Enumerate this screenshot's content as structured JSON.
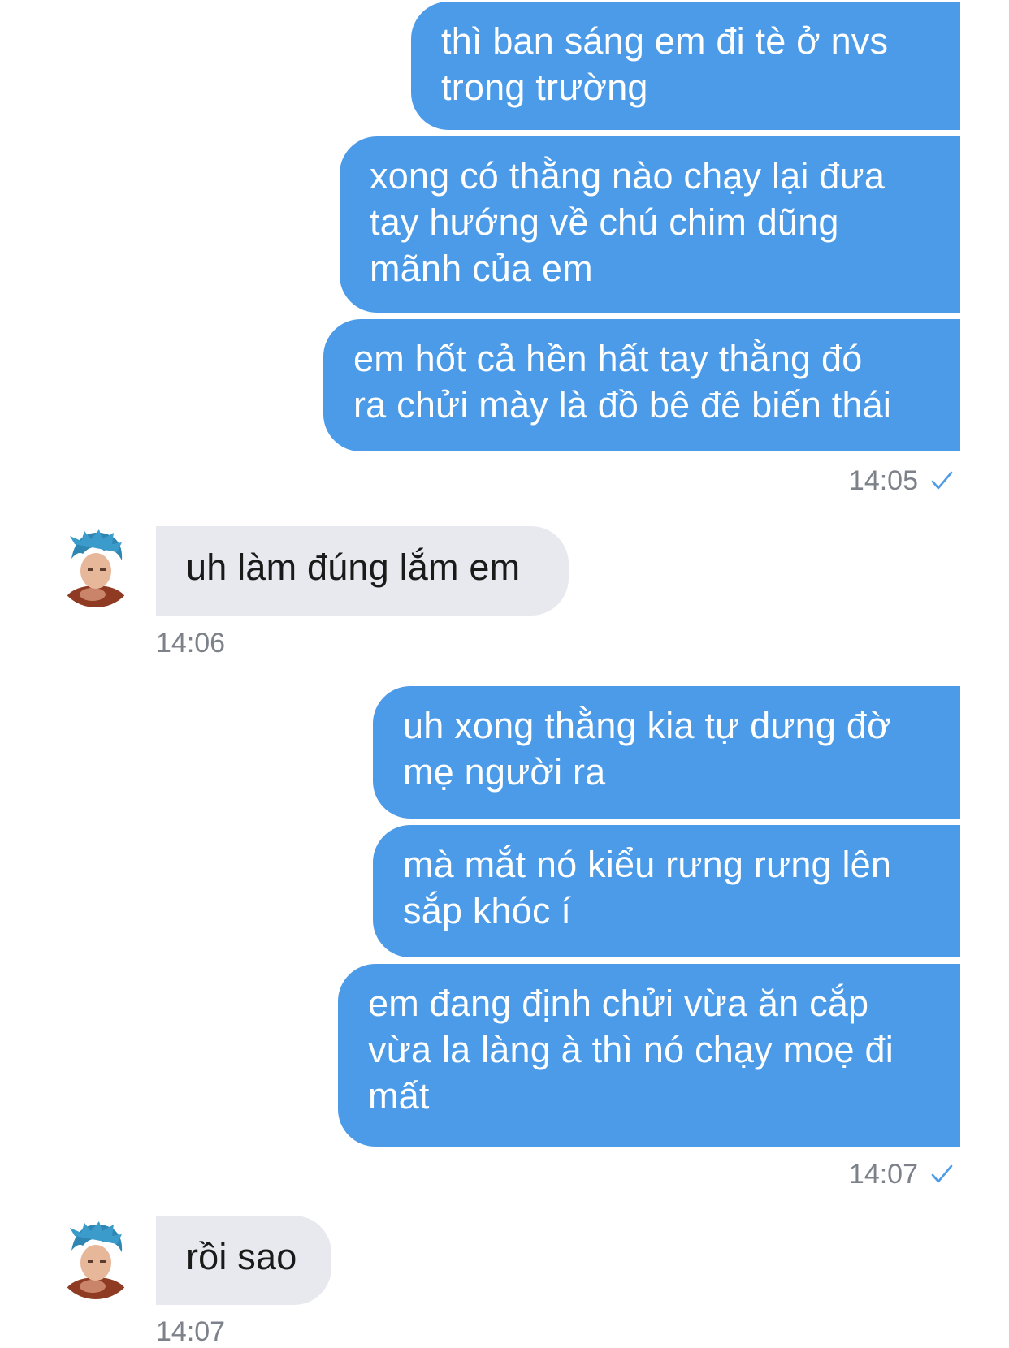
{
  "accent_color": "#4c9be8",
  "incoming_bubble_color": "#e8e9ee",
  "read_icon": "check-icon",
  "avatar_icon": "avatar-blue-hair-photo",
  "messages": [
    {
      "side": "out",
      "bubbles": [
        "thì ban sáng em đi tè ở nvs\ntrong trường",
        "xong có thằng nào chạy lại đưa\ntay hướng về chú chim dũng\nmãnh của em",
        "em hốt cả hền hất tay thằng đó\nra chửi mày là đồ bê đê biến thái"
      ],
      "time": "14:05"
    },
    {
      "side": "in",
      "bubbles": [
        "uh làm đúng lắm em"
      ],
      "time": "14:06"
    },
    {
      "side": "out",
      "bubbles": [
        "uh xong thằng kia tự dưng đờ\nmẹ người ra",
        "mà mắt nó kiểu rưng rưng lên\nsắp khóc í",
        "em đang định chửi vừa ăn cắp\nvừa la làng à thì nó chạy moẹ đi\nmất"
      ],
      "time": "14:07"
    },
    {
      "side": "in",
      "bubbles": [
        "rồi sao"
      ],
      "time": "14:07"
    }
  ]
}
